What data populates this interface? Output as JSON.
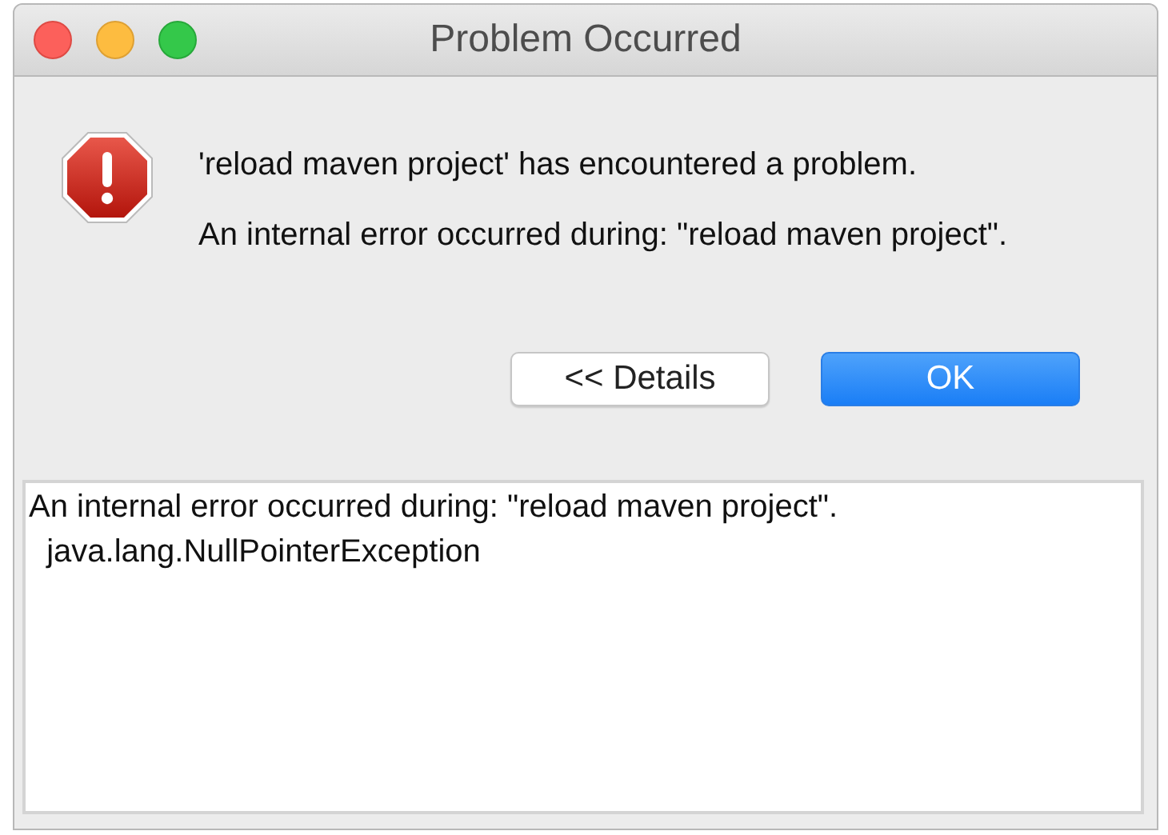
{
  "window": {
    "title": "Problem Occurred"
  },
  "message": {
    "headline": "'reload maven project' has encountered a problem.",
    "detail": "An internal error occurred during: \"reload maven project\"."
  },
  "buttons": [
    {
      "label": "<< Details",
      "default": false
    },
    {
      "label": "OK",
      "default": true
    }
  ],
  "details": {
    "lines": [
      "An internal error occurred during: \"reload maven project\".",
      "  java.lang.NullPointerException"
    ]
  }
}
